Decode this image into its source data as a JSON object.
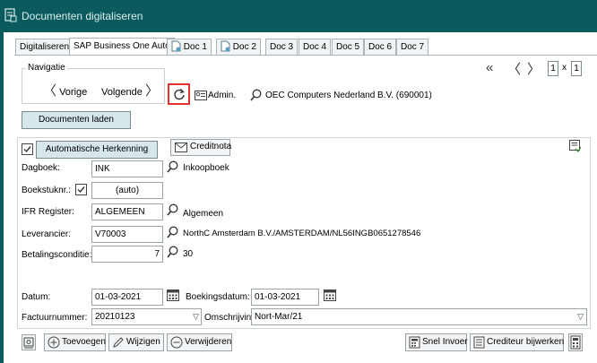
{
  "window": {
    "title": "Documenten digitaliseren",
    "icon": "document-scan-icon"
  },
  "tabs": [
    {
      "label": "Digitaliseren",
      "active": false,
      "icon": null
    },
    {
      "label": "SAP Business One Auto",
      "active": true,
      "icon": null
    },
    {
      "label": "Doc 1",
      "active": false,
      "icon": "document-icon"
    },
    {
      "label": "Doc 2",
      "active": false,
      "icon": "document-icon"
    },
    {
      "label": "Doc 3",
      "active": false,
      "icon": null
    },
    {
      "label": "Doc 4",
      "active": false,
      "icon": null
    },
    {
      "label": "Doc 5",
      "active": false,
      "icon": null
    },
    {
      "label": "Doc 6",
      "active": false,
      "icon": null
    },
    {
      "label": "Doc 7",
      "active": false,
      "icon": null
    }
  ],
  "navigation": {
    "legend": "Navigatie",
    "prev_label": "Vorige",
    "next_label": "Volgende",
    "admin_label": "Admin.",
    "company": "OEC Computers Nederland B.V. (690001)"
  },
  "pager": {
    "current": "1",
    "separator": "x",
    "total": "1"
  },
  "load_button": "Documenten laden",
  "form": {
    "auto_recognition_checked": true,
    "auto_recognition_label": "Automatische Herkenning",
    "creditnota_label": "Creditnota",
    "dagboek": {
      "label": "Dagboek:",
      "value": "INK",
      "desc": "Inkoopboek"
    },
    "boekstuknr": {
      "label": "Boekstuknr.:",
      "checked": true,
      "value": "(auto)"
    },
    "ifr": {
      "label": "IFR Register:",
      "value": "ALGEMEEN",
      "desc": "Algemeen"
    },
    "leverancier": {
      "label": "Leverancier:",
      "value": "V70003",
      "desc": "NorthC Amsterdam B.V./AMSTERDAM/NL56INGB0651278546"
    },
    "betalingsconditie": {
      "label": "Betalingsconditie:",
      "value": "7",
      "desc": "30"
    },
    "datum": {
      "label": "Datum:",
      "value": "01-03-2021"
    },
    "boekingsdatum": {
      "label": "Boekingsdatum:",
      "value": "01-03-2021"
    },
    "factuurnummer": {
      "label": "Factuurnummer:",
      "value": "20210123"
    },
    "omschrijving": {
      "label": "Omschrijving:",
      "value": "Nort-Mar/21"
    }
  },
  "bottom_toolbar": {
    "add": "Toevoegen",
    "edit": "Wijzigen",
    "delete": "Verwijderen",
    "quick_entry": "Snel Invoer",
    "edit_creditor": "Crediteur bijwerken"
  },
  "colors": {
    "titlebar": "#0b5a5e",
    "highlight": "#e0332b",
    "button": "#d6e6ea"
  }
}
